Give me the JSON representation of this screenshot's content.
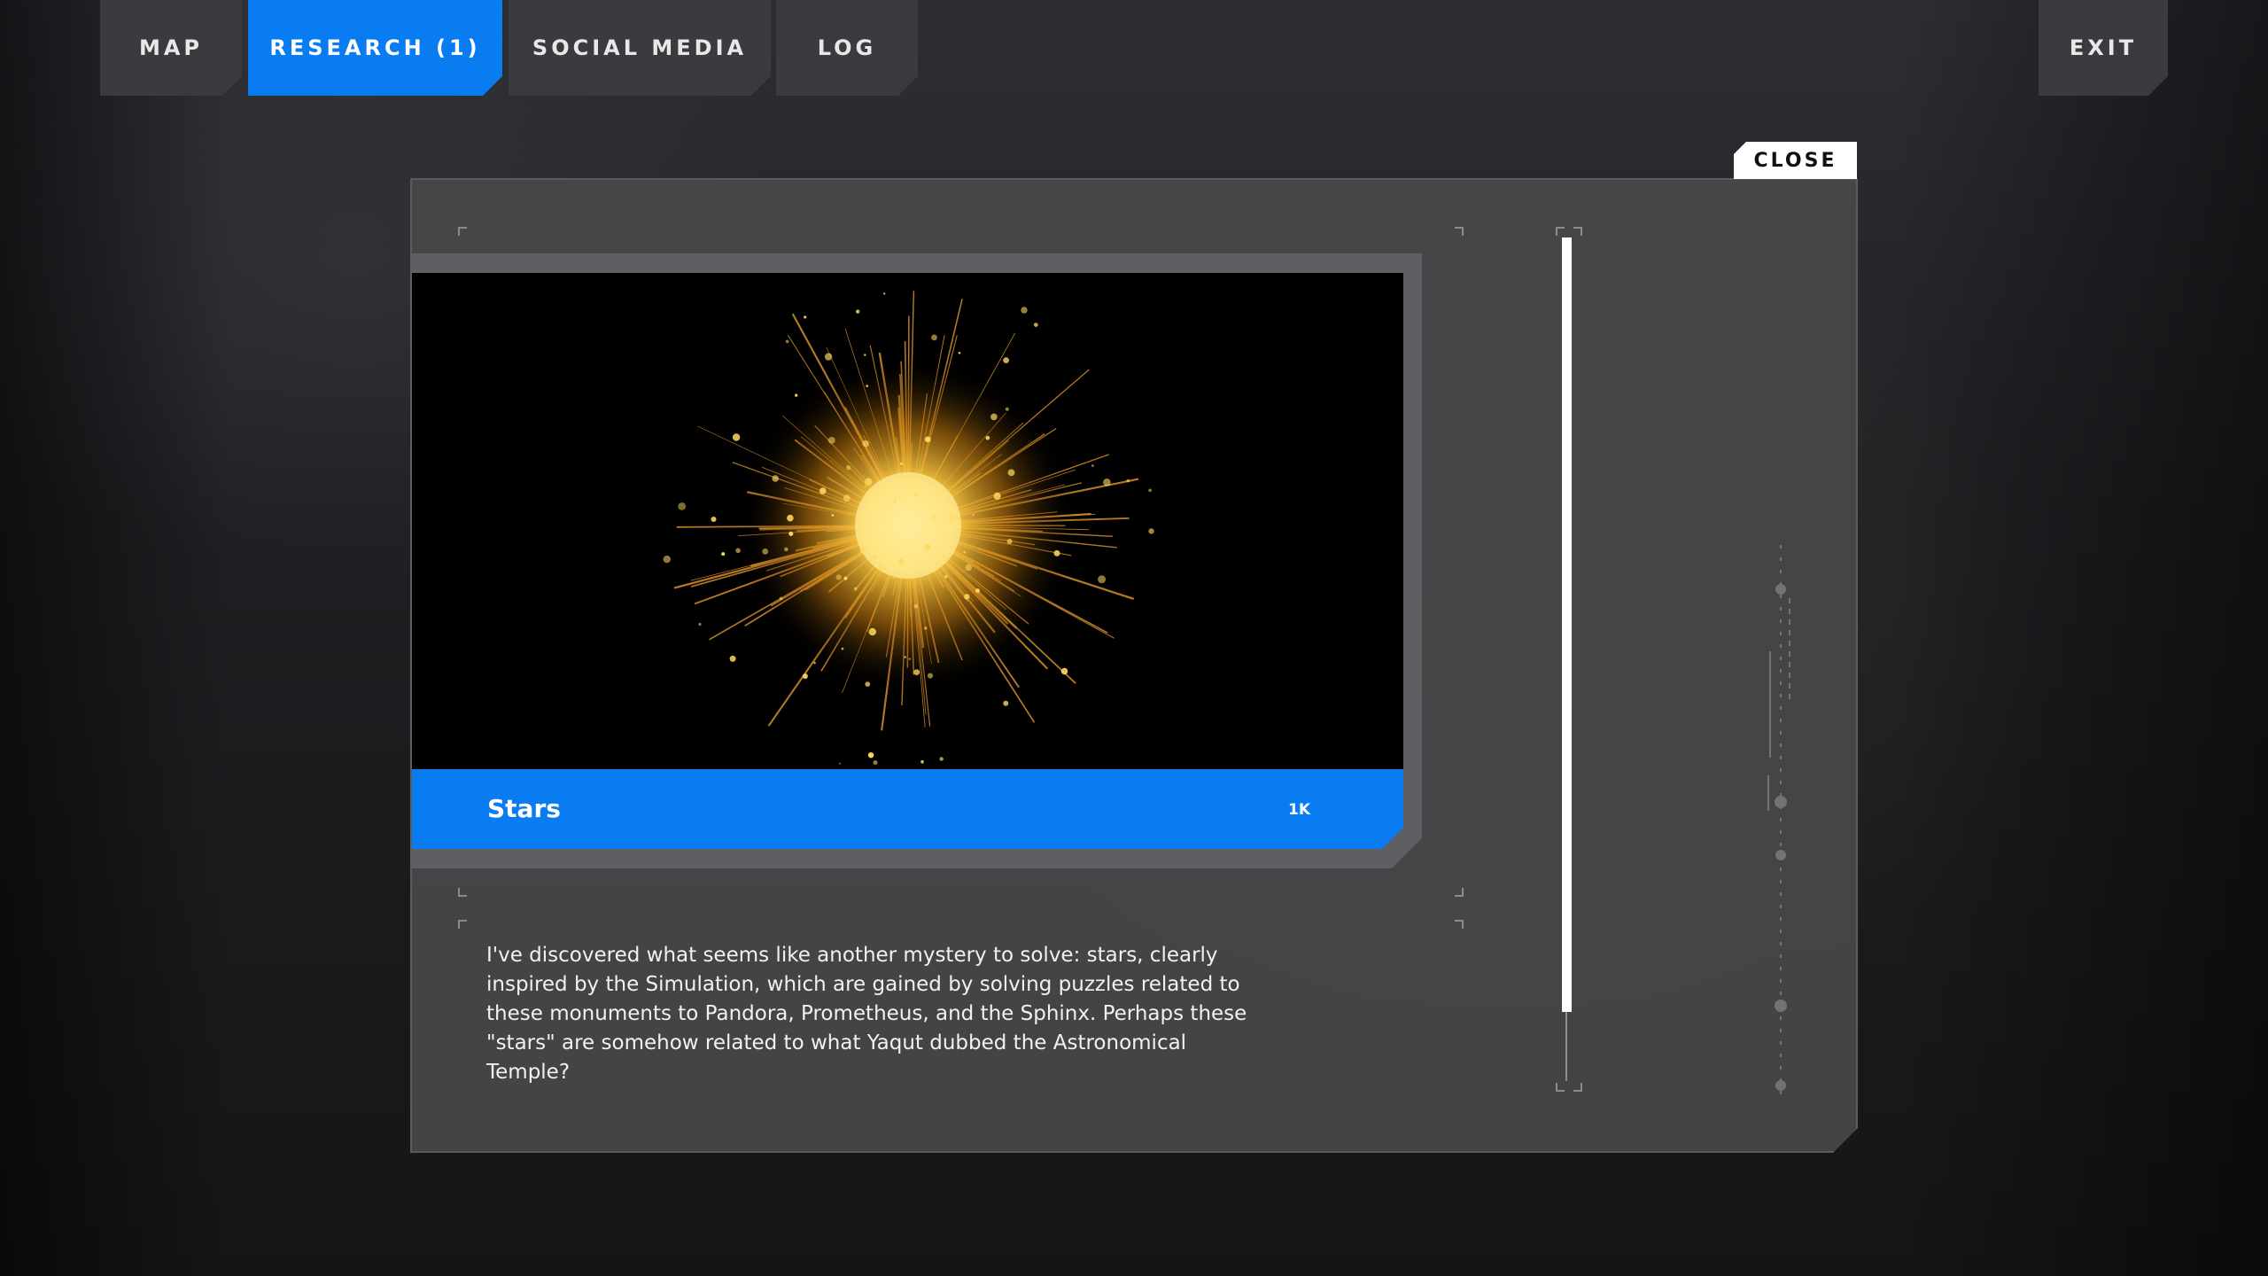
{
  "nav": {
    "tabs": [
      {
        "label": "MAP"
      },
      {
        "label": "RESEARCH (1)"
      },
      {
        "label": "SOCIAL MEDIA"
      },
      {
        "label": "LOG"
      }
    ],
    "exit_label": "EXIT"
  },
  "panel": {
    "close_label": "CLOSE",
    "card": {
      "title": "Stars",
      "badge": "1K"
    },
    "description": "I've discovered what seems like another mystery to solve: stars, clearly inspired by the Simulation, which are gained by solving puzzles related to these monuments to Pandora, Prometheus, and the Sphinx. Perhaps these \"stars\" are somehow related to what Yaqut dubbed the Astronomical Temple?",
    "scroll_position": 0.0
  },
  "colors": {
    "accent": "#0a7cf2",
    "tab_bg": "#3a3b3e",
    "panel_bg": "#48484a"
  }
}
